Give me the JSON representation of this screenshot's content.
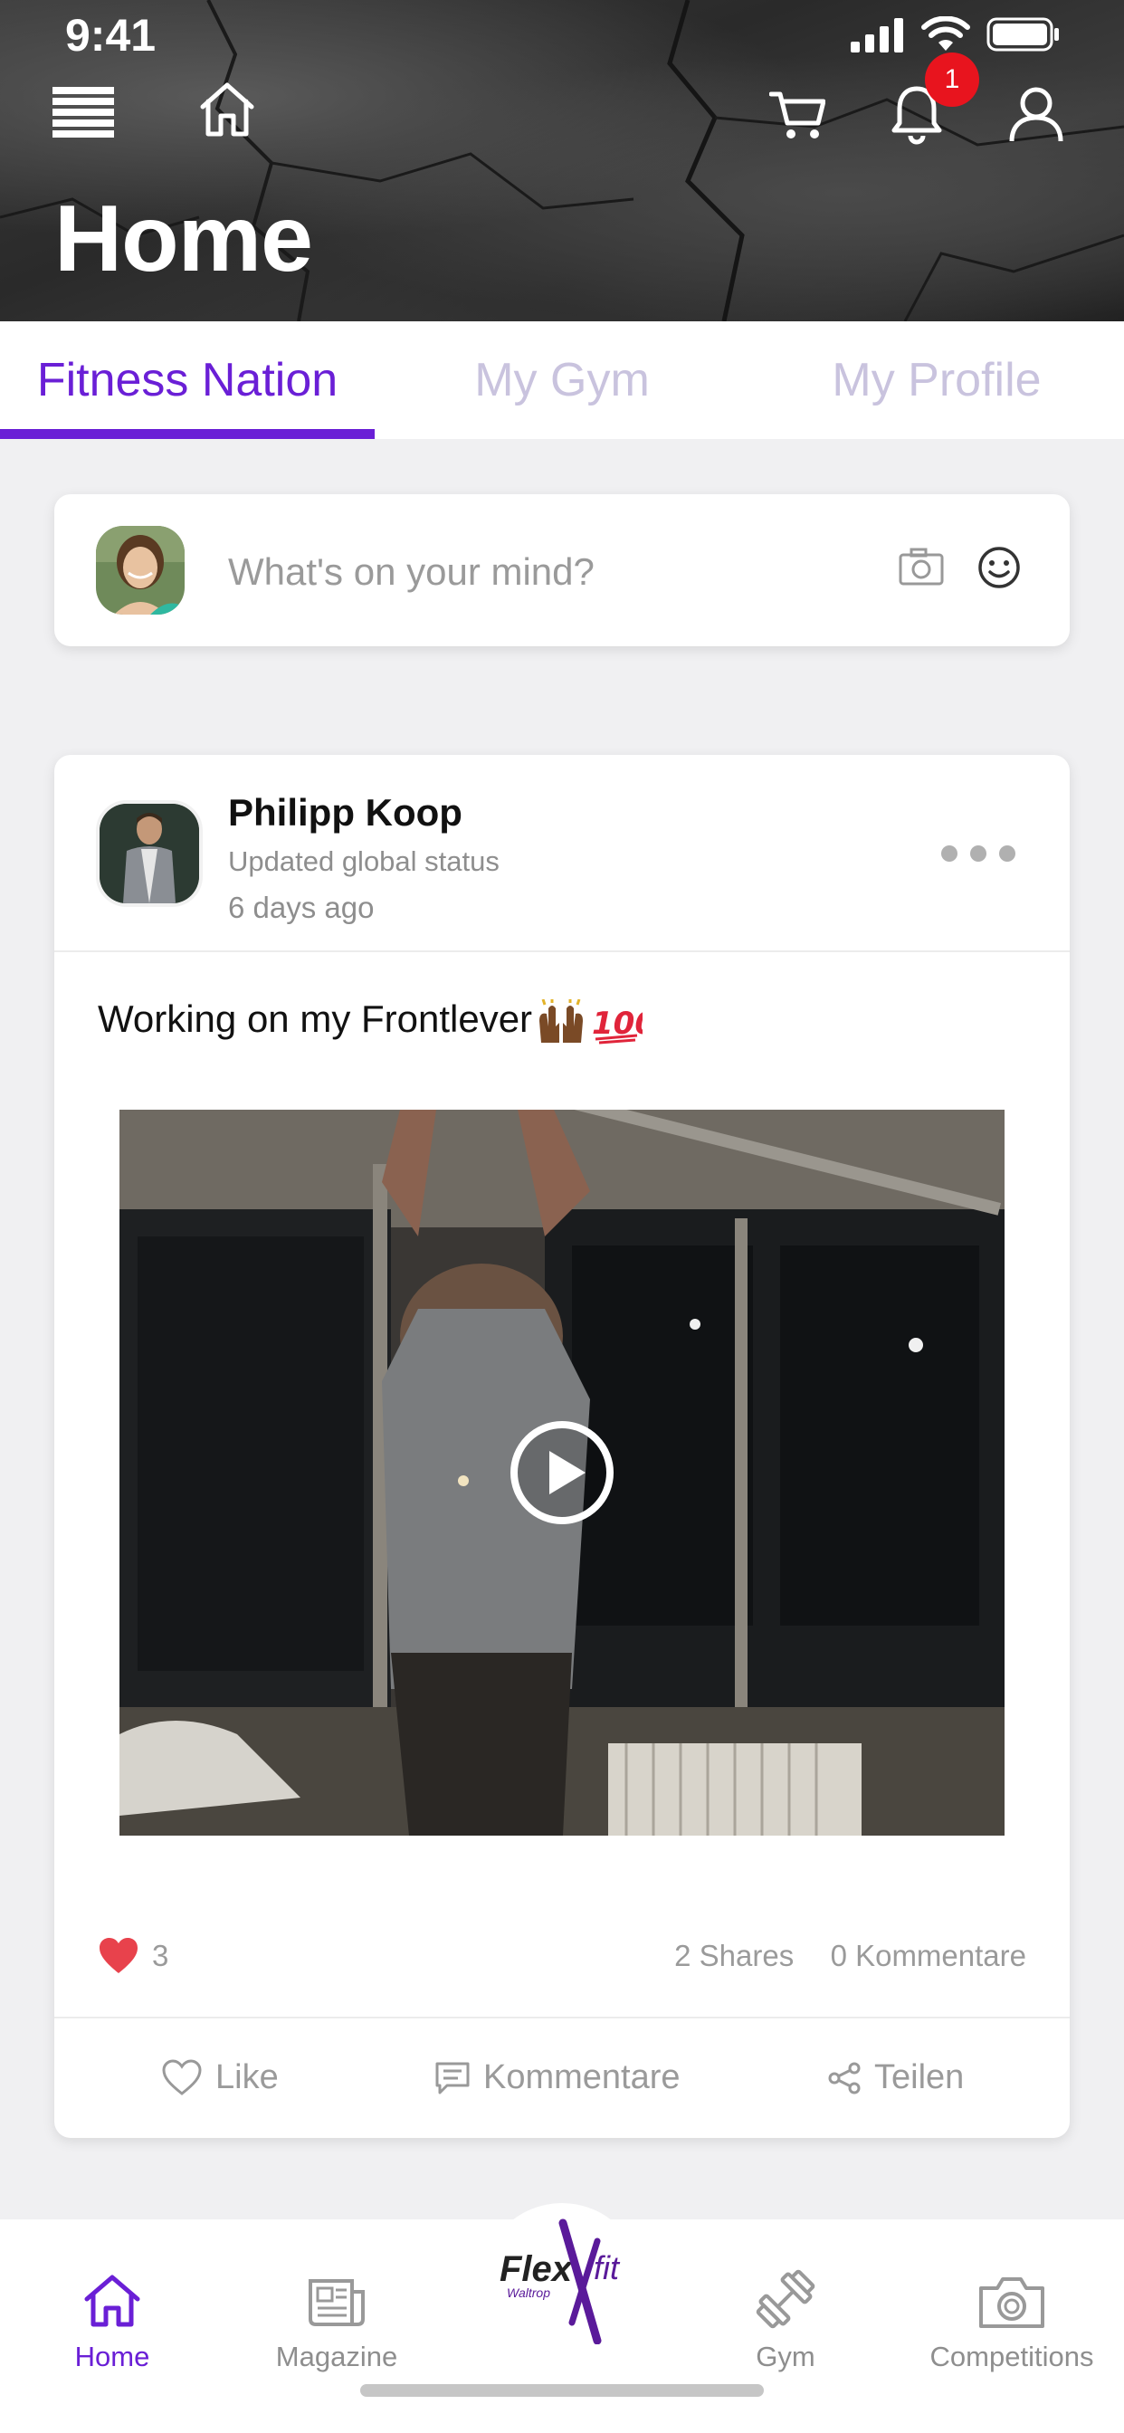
{
  "status_bar": {
    "time": "9:41"
  },
  "header": {
    "title": "Home",
    "notification_count": "1"
  },
  "tabs": [
    {
      "label": "Fitness Nation",
      "active": true
    },
    {
      "label": "My Gym",
      "active": false
    },
    {
      "label": "My Profile",
      "active": false
    }
  ],
  "composer": {
    "placeholder": "What's on your mind?"
  },
  "post": {
    "author": "Philipp Koop",
    "subtitle": "Updated global status",
    "time": "6 days ago",
    "text": "Working on my Frontlever",
    "likes": "3",
    "shares": "2 Shares",
    "comments": "0 Kommentare",
    "actions": {
      "like": "Like",
      "comment": "Kommentare",
      "share": "Teilen"
    }
  },
  "bottom_nav": [
    {
      "label": "Home",
      "icon": "home-icon",
      "active": true
    },
    {
      "label": "Magazine",
      "icon": "newspaper-icon",
      "active": false
    },
    {
      "label": "Flex fit",
      "icon": "flexfit-logo",
      "active": false
    },
    {
      "label": "Gym",
      "icon": "dumbbell-icon",
      "active": false
    },
    {
      "label": "Competitions",
      "icon": "camera-icon",
      "active": false
    }
  ],
  "logo": {
    "word1": "Flex",
    "word2": "fit",
    "tagline": "Waltrop"
  },
  "colors": {
    "accent": "#6a1fd6",
    "badge": "#e8141e",
    "heart": "#e8424c"
  }
}
